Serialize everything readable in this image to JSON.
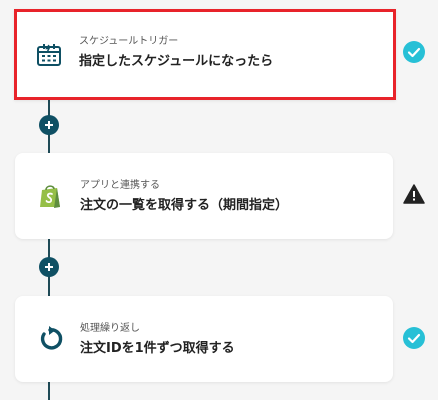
{
  "flow": {
    "steps": [
      {
        "subtitle": "スケジュールトリガー",
        "title": "指定したスケジュールになったら",
        "icon": "calendar-icon",
        "status": "success",
        "selected": true
      },
      {
        "subtitle": "アプリと連携する",
        "title": "注文の一覧を取得する（期間指定）",
        "icon": "shopify-icon",
        "status": "warning",
        "selected": false
      },
      {
        "subtitle": "処理繰り返し",
        "title": "注文IDを1件ずつ取得する",
        "icon": "loop-icon",
        "status": "success",
        "selected": false
      }
    ]
  },
  "colors": {
    "accent_dark": "#0f5064",
    "success": "#27c0d6",
    "warning": "#222222",
    "selection_border": "#e8232a",
    "shopify_green": "#95bf47"
  }
}
